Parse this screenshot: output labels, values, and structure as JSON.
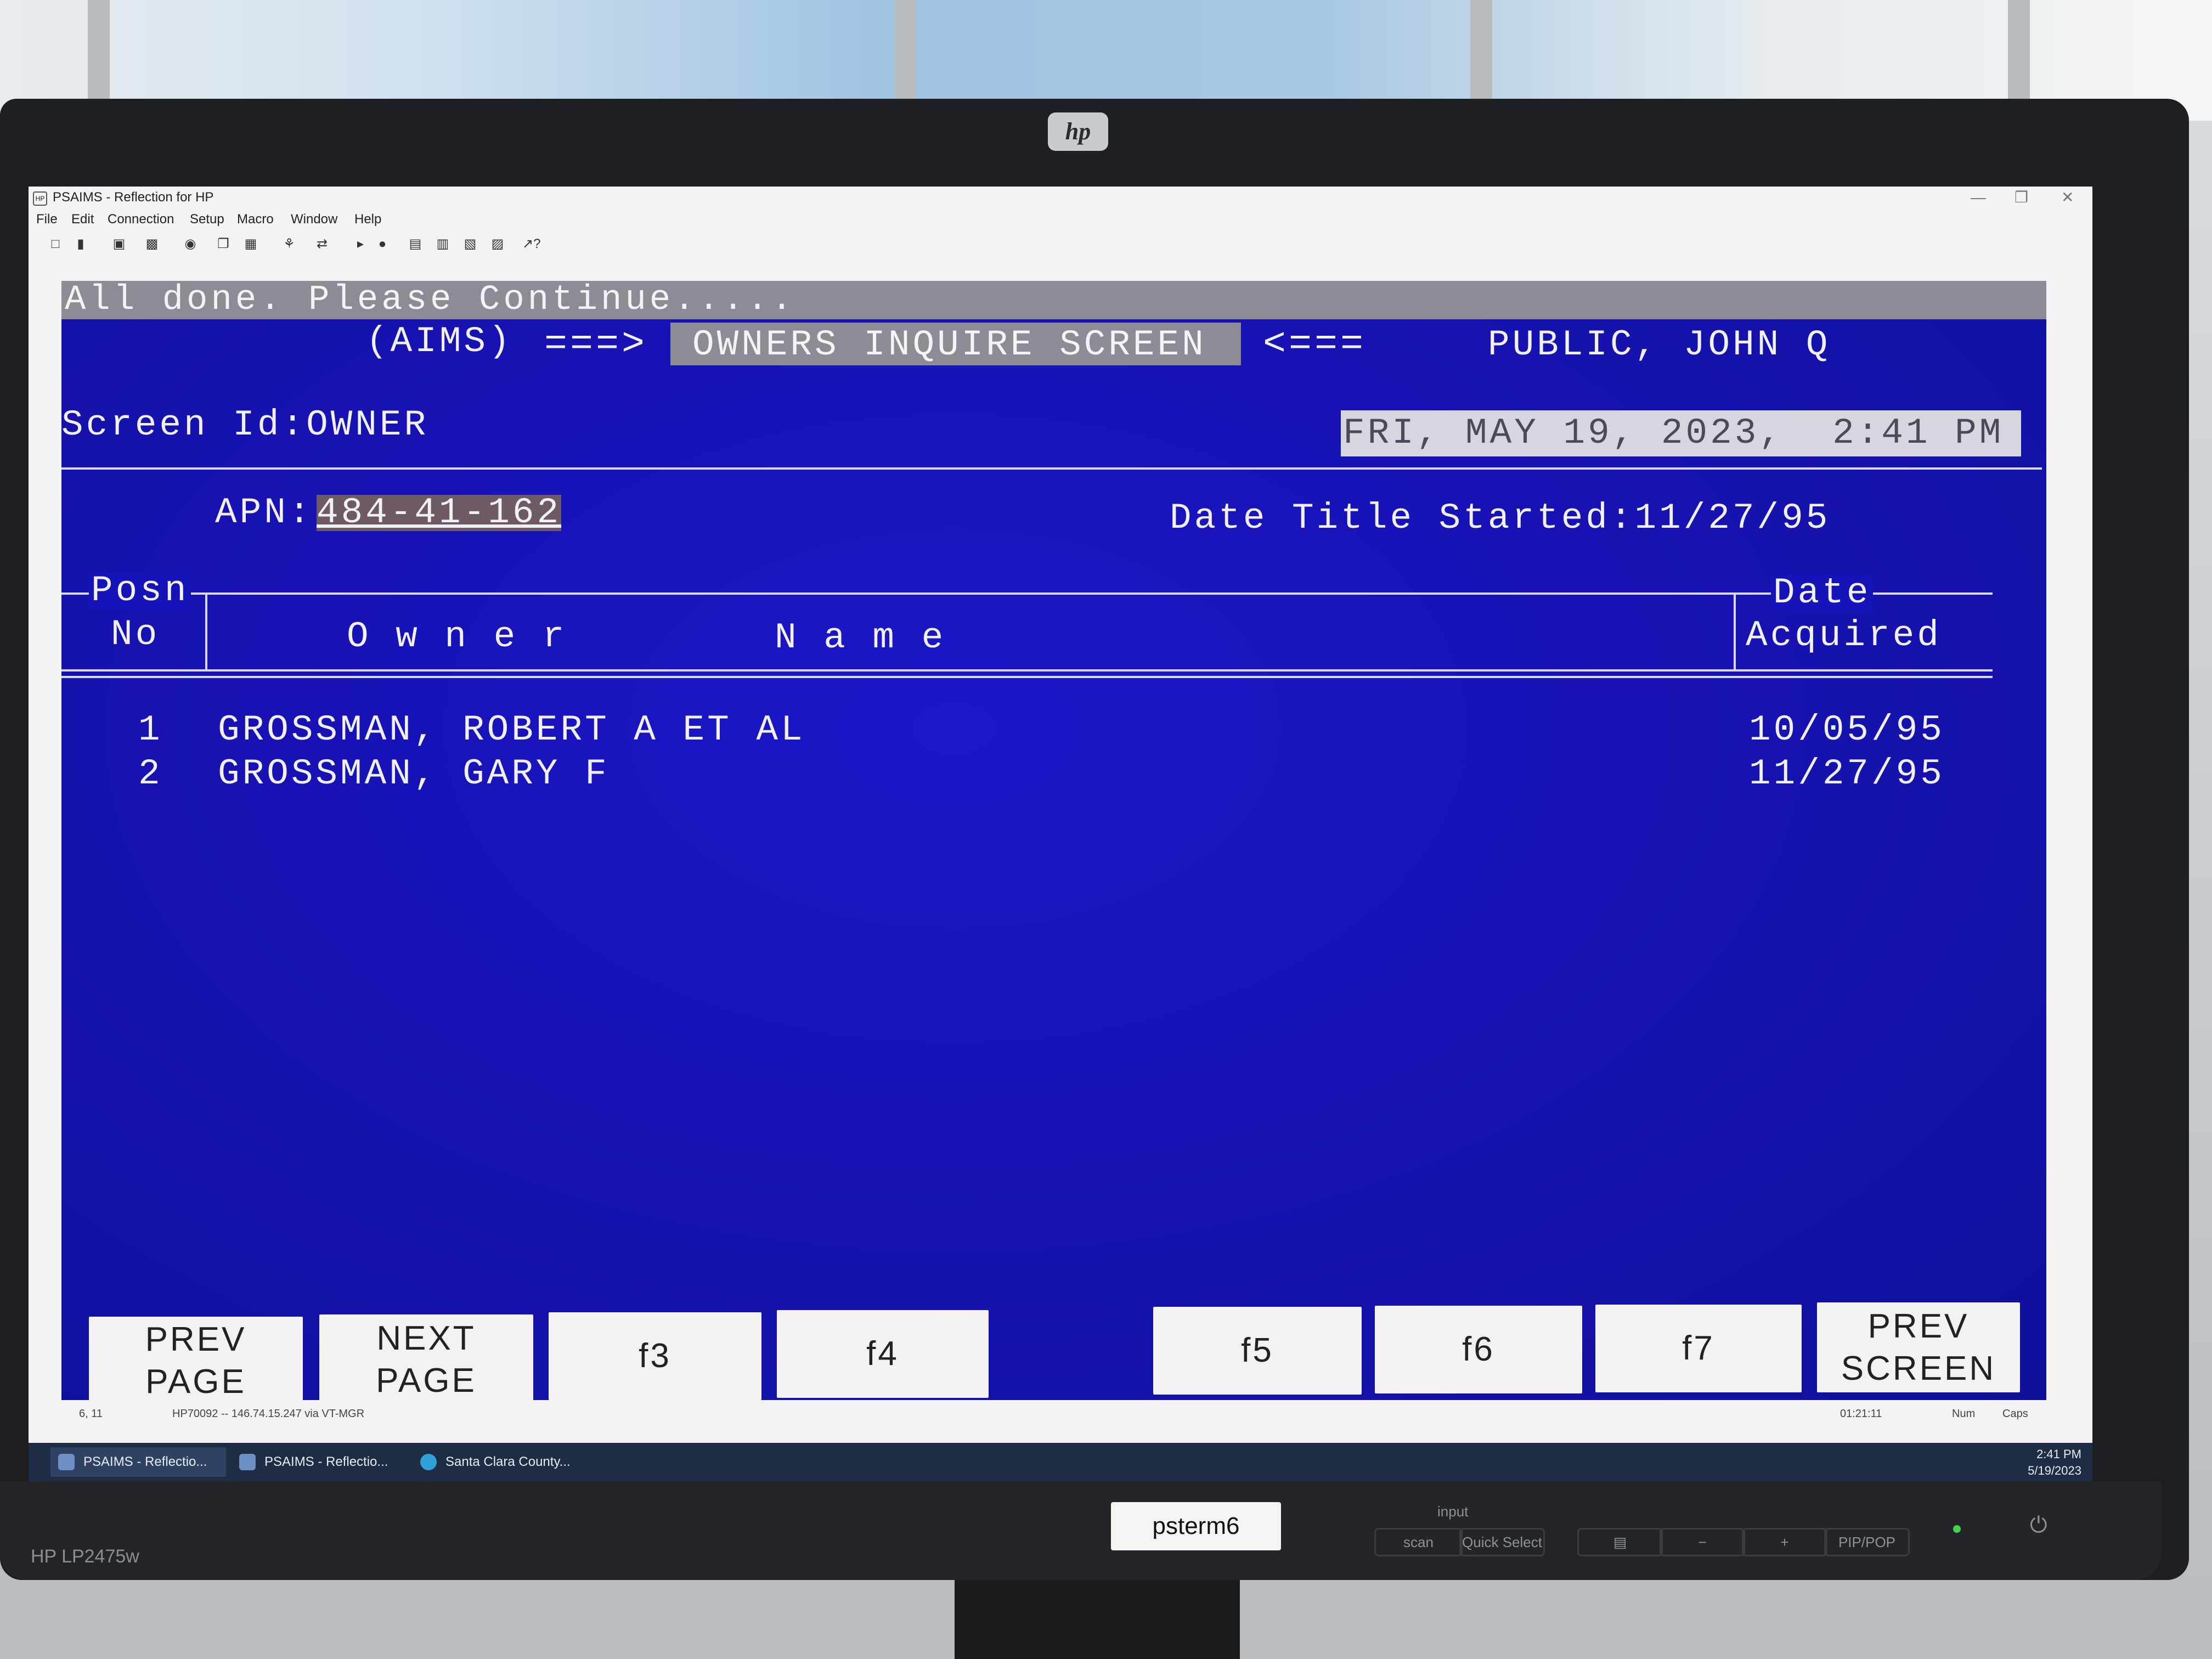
{
  "window": {
    "title": "PSAIMS - Reflection for HP",
    "menu": [
      "File",
      "Edit",
      "Connection",
      "Setup",
      "Macro",
      "Window",
      "Help"
    ]
  },
  "terminal": {
    "message": "All done.  Please Continue.....",
    "system": "(AIMS)",
    "arrow_right": "===>",
    "screen_title": "OWNERS INQUIRE SCREEN",
    "arrow_left": "<===",
    "user": "PUBLIC, JOHN Q",
    "screen_id": "Screen Id:OWNER",
    "datetime": "FRI, MAY 19, 2023,  2:41 PM",
    "apn_label": "APN:",
    "apn_value": "484-41-162",
    "date_title_started": "Date Title Started:11/27/95",
    "columns": {
      "posn": "Posn",
      "no": "No",
      "owner": "O w n e r",
      "name": "N a m e",
      "date": "Date",
      "acquired": "Acquired"
    },
    "rows": [
      {
        "no": "1",
        "owner": "GROSSMAN, ROBERT A ET AL",
        "date": "10/05/95"
      },
      {
        "no": "2",
        "owner": "GROSSMAN, GARY F",
        "date": "11/27/95"
      }
    ]
  },
  "function_keys": [
    {
      "label": "PREV\nPAGE"
    },
    {
      "label": "NEXT\nPAGE"
    },
    {
      "label": "f3"
    },
    {
      "label": "f4"
    },
    {
      "label": "f5"
    },
    {
      "label": "f6"
    },
    {
      "label": "f7"
    },
    {
      "label": "PREV\nSCREEN"
    }
  ],
  "statusbar": {
    "cursor": "6, 11",
    "connection": "HP70092 -- 146.74.15.247 via VT-MGR",
    "timer": "01:21:11",
    "num": "Num",
    "caps": "Caps"
  },
  "taskbar": {
    "items": [
      "PSAIMS - Reflectio...",
      "PSAIMS - Reflectio...",
      "Santa Clara County..."
    ],
    "time": "2:41 PM",
    "date": "5/19/2023"
  },
  "monitor": {
    "model": "HP LP2475w",
    "tag": "psterm6",
    "osd_input": "input",
    "osd_scan": "scan",
    "osd_quick_select": "Quick Select",
    "osd_pip": "PIP/POP"
  }
}
